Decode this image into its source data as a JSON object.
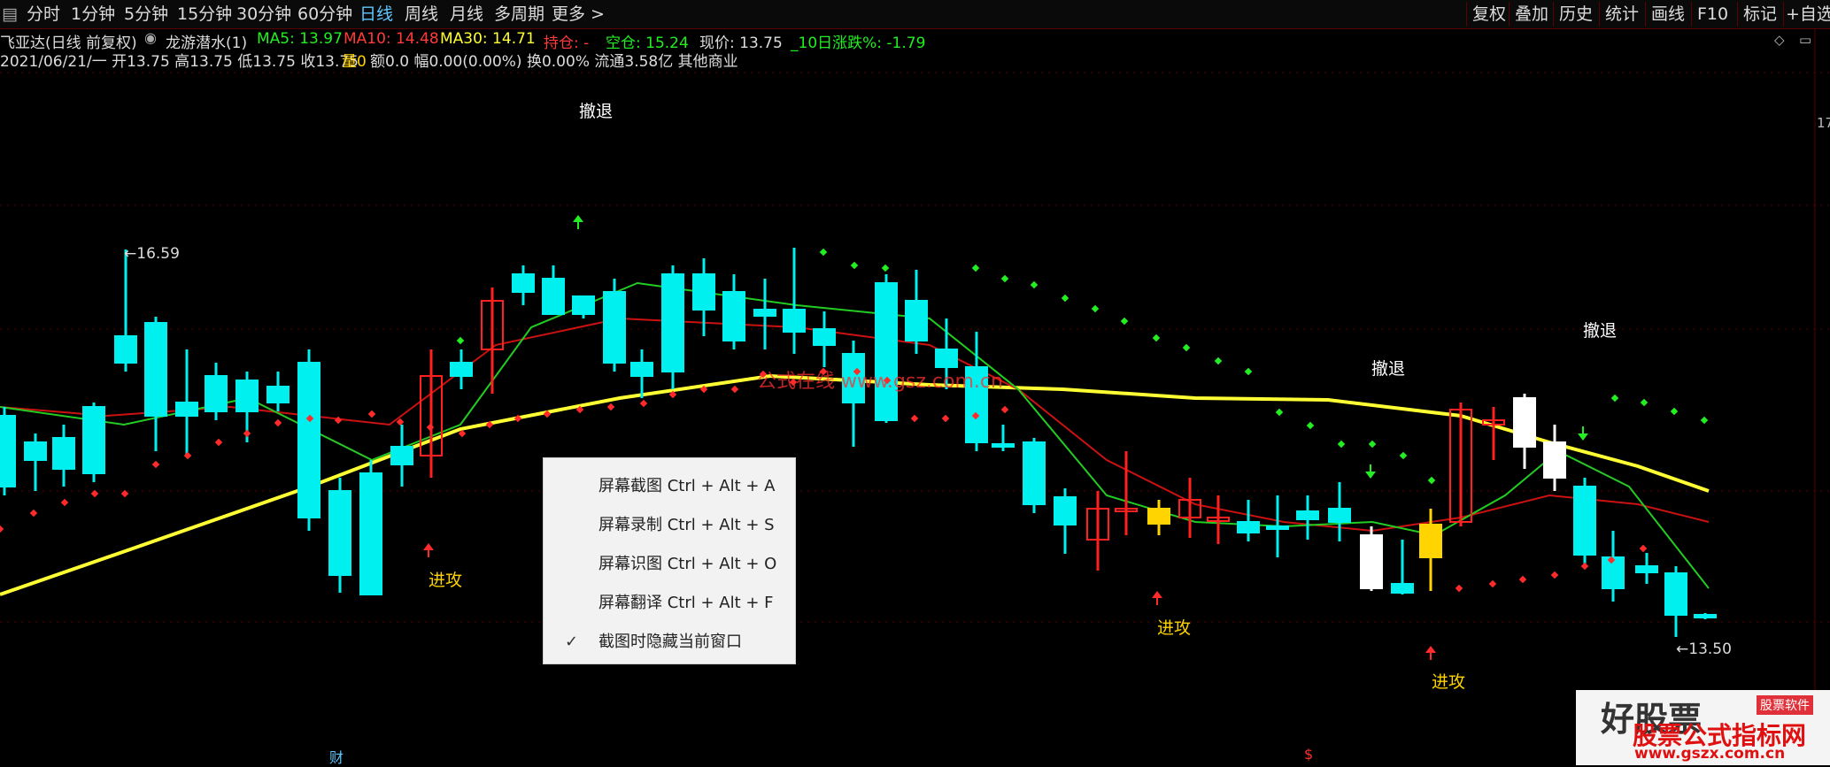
{
  "toolbar": {
    "left_icon": "▤",
    "periods": [
      "分时",
      "1分钟",
      "5分钟",
      "15分钟",
      "30分钟",
      "60分钟",
      "日线",
      "周线",
      "月线",
      "多周期",
      "更多 >"
    ],
    "selected": "日线",
    "right": [
      "复权",
      "叠加",
      "历史",
      "统计",
      "画线",
      "F10",
      "标记",
      "+自选"
    ]
  },
  "info": {
    "stock": "飞亚达(日线 前复权)",
    "indicator": "龙游潜水(1)",
    "ma5": "MA5: 13.97",
    "ma10": "MA10: 14.48",
    "ma30": "MA30: 14.71",
    "hold": "持仓: -",
    "empty": "空仓: 15.24",
    "price": "现价: 13.75",
    "change10": "_10日涨跌%: -1.79",
    "line2_a": "2021/06/21/一 开13.75 高13.75 低13.75 收13.75",
    "line2_vol": "量0",
    "line2_b": "额0.0 幅0.00(0.00%) 换0.00% 流通3.58亿 其他商业",
    "watermark": "公式在线 www.gsz.com.cn",
    "footer_left": "财",
    "footer_mid": "$",
    "right_mark": "17"
  },
  "labels": {
    "high": "16.59",
    "low": "13.50",
    "attack": "进攻",
    "retreat": "撤退"
  },
  "menu": {
    "items": [
      {
        "label": "屏幕截图 Ctrl + Alt + A",
        "checked": false
      },
      {
        "label": "屏幕录制 Ctrl + Alt + S",
        "checked": false
      },
      {
        "label": "屏幕识图 Ctrl + Alt + O",
        "checked": false
      },
      {
        "label": "屏幕翻译 Ctrl + Alt + F",
        "checked": false
      },
      {
        "label": "截图时隐藏当前窗口",
        "checked": true
      }
    ]
  },
  "logo": {
    "main": "股票公式指标网",
    "site": "www.gszx.com.cn",
    "tag": "股票软件",
    "brand": "好股票"
  },
  "colors": {
    "up": "#ff2020",
    "down": "#00f0f0",
    "ma30": "#ffff33",
    "ma5": "#22cc22",
    "ma10": "#cc1111",
    "dot_up": "#ff2a2a",
    "dot_down": "#22ee22",
    "attack": "#ffd400",
    "retreat": "#ffffff",
    "accent": "#5fc8ff"
  }
}
